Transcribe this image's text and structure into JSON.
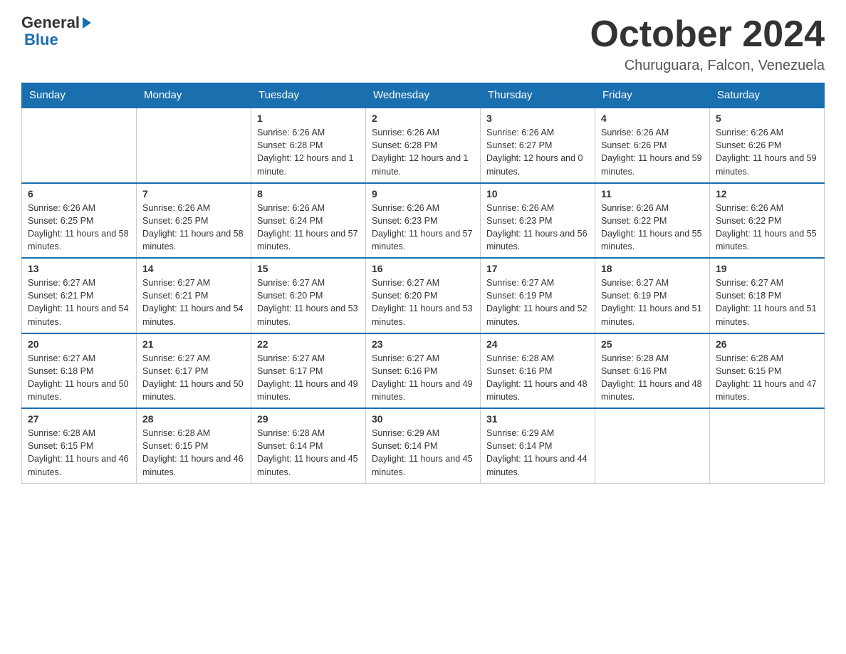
{
  "header": {
    "logo_text_general": "General",
    "logo_text_blue": "Blue",
    "month_title": "October 2024",
    "location": "Churuguara, Falcon, Venezuela"
  },
  "weekdays": [
    "Sunday",
    "Monday",
    "Tuesday",
    "Wednesday",
    "Thursday",
    "Friday",
    "Saturday"
  ],
  "weeks": [
    [
      {
        "day": "",
        "sunrise": "",
        "sunset": "",
        "daylight": ""
      },
      {
        "day": "",
        "sunrise": "",
        "sunset": "",
        "daylight": ""
      },
      {
        "day": "1",
        "sunrise": "Sunrise: 6:26 AM",
        "sunset": "Sunset: 6:28 PM",
        "daylight": "Daylight: 12 hours and 1 minute."
      },
      {
        "day": "2",
        "sunrise": "Sunrise: 6:26 AM",
        "sunset": "Sunset: 6:28 PM",
        "daylight": "Daylight: 12 hours and 1 minute."
      },
      {
        "day": "3",
        "sunrise": "Sunrise: 6:26 AM",
        "sunset": "Sunset: 6:27 PM",
        "daylight": "Daylight: 12 hours and 0 minutes."
      },
      {
        "day": "4",
        "sunrise": "Sunrise: 6:26 AM",
        "sunset": "Sunset: 6:26 PM",
        "daylight": "Daylight: 11 hours and 59 minutes."
      },
      {
        "day": "5",
        "sunrise": "Sunrise: 6:26 AM",
        "sunset": "Sunset: 6:26 PM",
        "daylight": "Daylight: 11 hours and 59 minutes."
      }
    ],
    [
      {
        "day": "6",
        "sunrise": "Sunrise: 6:26 AM",
        "sunset": "Sunset: 6:25 PM",
        "daylight": "Daylight: 11 hours and 58 minutes."
      },
      {
        "day": "7",
        "sunrise": "Sunrise: 6:26 AM",
        "sunset": "Sunset: 6:25 PM",
        "daylight": "Daylight: 11 hours and 58 minutes."
      },
      {
        "day": "8",
        "sunrise": "Sunrise: 6:26 AM",
        "sunset": "Sunset: 6:24 PM",
        "daylight": "Daylight: 11 hours and 57 minutes."
      },
      {
        "day": "9",
        "sunrise": "Sunrise: 6:26 AM",
        "sunset": "Sunset: 6:23 PM",
        "daylight": "Daylight: 11 hours and 57 minutes."
      },
      {
        "day": "10",
        "sunrise": "Sunrise: 6:26 AM",
        "sunset": "Sunset: 6:23 PM",
        "daylight": "Daylight: 11 hours and 56 minutes."
      },
      {
        "day": "11",
        "sunrise": "Sunrise: 6:26 AM",
        "sunset": "Sunset: 6:22 PM",
        "daylight": "Daylight: 11 hours and 55 minutes."
      },
      {
        "day": "12",
        "sunrise": "Sunrise: 6:26 AM",
        "sunset": "Sunset: 6:22 PM",
        "daylight": "Daylight: 11 hours and 55 minutes."
      }
    ],
    [
      {
        "day": "13",
        "sunrise": "Sunrise: 6:27 AM",
        "sunset": "Sunset: 6:21 PM",
        "daylight": "Daylight: 11 hours and 54 minutes."
      },
      {
        "day": "14",
        "sunrise": "Sunrise: 6:27 AM",
        "sunset": "Sunset: 6:21 PM",
        "daylight": "Daylight: 11 hours and 54 minutes."
      },
      {
        "day": "15",
        "sunrise": "Sunrise: 6:27 AM",
        "sunset": "Sunset: 6:20 PM",
        "daylight": "Daylight: 11 hours and 53 minutes."
      },
      {
        "day": "16",
        "sunrise": "Sunrise: 6:27 AM",
        "sunset": "Sunset: 6:20 PM",
        "daylight": "Daylight: 11 hours and 53 minutes."
      },
      {
        "day": "17",
        "sunrise": "Sunrise: 6:27 AM",
        "sunset": "Sunset: 6:19 PM",
        "daylight": "Daylight: 11 hours and 52 minutes."
      },
      {
        "day": "18",
        "sunrise": "Sunrise: 6:27 AM",
        "sunset": "Sunset: 6:19 PM",
        "daylight": "Daylight: 11 hours and 51 minutes."
      },
      {
        "day": "19",
        "sunrise": "Sunrise: 6:27 AM",
        "sunset": "Sunset: 6:18 PM",
        "daylight": "Daylight: 11 hours and 51 minutes."
      }
    ],
    [
      {
        "day": "20",
        "sunrise": "Sunrise: 6:27 AM",
        "sunset": "Sunset: 6:18 PM",
        "daylight": "Daylight: 11 hours and 50 minutes."
      },
      {
        "day": "21",
        "sunrise": "Sunrise: 6:27 AM",
        "sunset": "Sunset: 6:17 PM",
        "daylight": "Daylight: 11 hours and 50 minutes."
      },
      {
        "day": "22",
        "sunrise": "Sunrise: 6:27 AM",
        "sunset": "Sunset: 6:17 PM",
        "daylight": "Daylight: 11 hours and 49 minutes."
      },
      {
        "day": "23",
        "sunrise": "Sunrise: 6:27 AM",
        "sunset": "Sunset: 6:16 PM",
        "daylight": "Daylight: 11 hours and 49 minutes."
      },
      {
        "day": "24",
        "sunrise": "Sunrise: 6:28 AM",
        "sunset": "Sunset: 6:16 PM",
        "daylight": "Daylight: 11 hours and 48 minutes."
      },
      {
        "day": "25",
        "sunrise": "Sunrise: 6:28 AM",
        "sunset": "Sunset: 6:16 PM",
        "daylight": "Daylight: 11 hours and 48 minutes."
      },
      {
        "day": "26",
        "sunrise": "Sunrise: 6:28 AM",
        "sunset": "Sunset: 6:15 PM",
        "daylight": "Daylight: 11 hours and 47 minutes."
      }
    ],
    [
      {
        "day": "27",
        "sunrise": "Sunrise: 6:28 AM",
        "sunset": "Sunset: 6:15 PM",
        "daylight": "Daylight: 11 hours and 46 minutes."
      },
      {
        "day": "28",
        "sunrise": "Sunrise: 6:28 AM",
        "sunset": "Sunset: 6:15 PM",
        "daylight": "Daylight: 11 hours and 46 minutes."
      },
      {
        "day": "29",
        "sunrise": "Sunrise: 6:28 AM",
        "sunset": "Sunset: 6:14 PM",
        "daylight": "Daylight: 11 hours and 45 minutes."
      },
      {
        "day": "30",
        "sunrise": "Sunrise: 6:29 AM",
        "sunset": "Sunset: 6:14 PM",
        "daylight": "Daylight: 11 hours and 45 minutes."
      },
      {
        "day": "31",
        "sunrise": "Sunrise: 6:29 AM",
        "sunset": "Sunset: 6:14 PM",
        "daylight": "Daylight: 11 hours and 44 minutes."
      },
      {
        "day": "",
        "sunrise": "",
        "sunset": "",
        "daylight": ""
      },
      {
        "day": "",
        "sunrise": "",
        "sunset": "",
        "daylight": ""
      }
    ]
  ]
}
